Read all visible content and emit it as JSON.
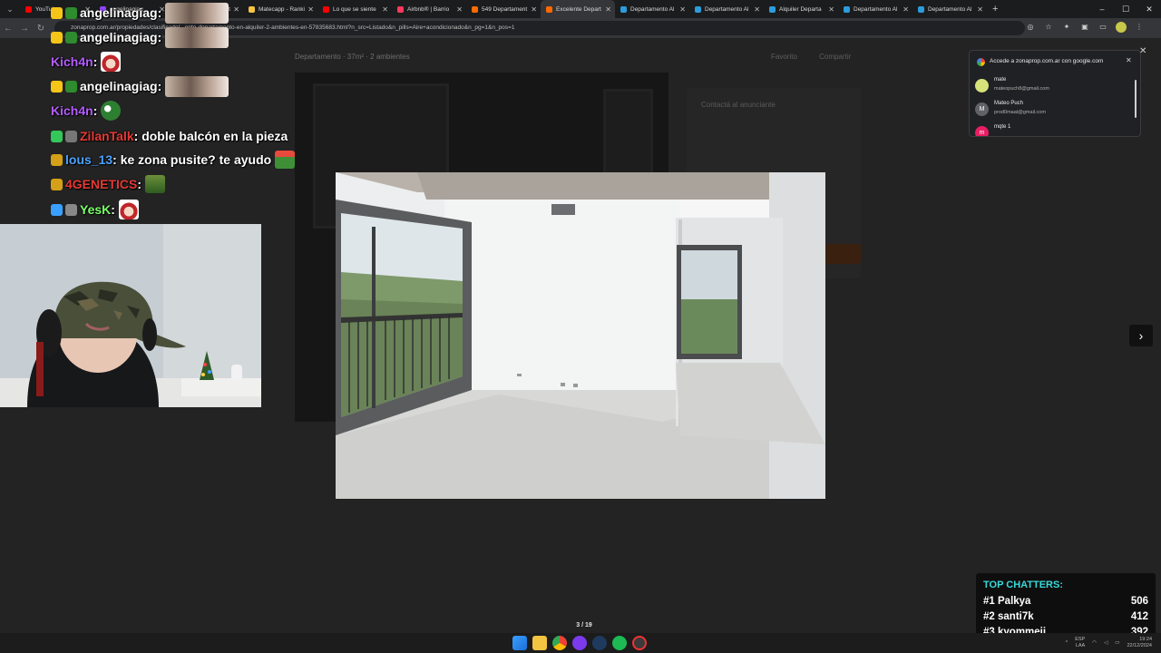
{
  "browser": {
    "tabs": [
      {
        "title": "YouTube",
        "color": "#ff0000"
      },
      {
        "title": "angelinagiag",
        "color": "#9146ff"
      },
      {
        "title": "KickBot VOD Edit",
        "color": "#53fc18"
      },
      {
        "title": "Matecapp - Ranki",
        "color": "#f5c542"
      },
      {
        "title": "Lo que se siente",
        "color": "#ff0000"
      },
      {
        "title": "Airbnb® | Barrio",
        "color": "#ff385c"
      },
      {
        "title": "549 Departament",
        "color": "#ff6a00"
      },
      {
        "title": "Excelente Depart",
        "color": "#ff6a00",
        "active": true
      },
      {
        "title": "Departamento Al",
        "color": "#2d9cdb"
      },
      {
        "title": "Departamento Al",
        "color": "#2d9cdb"
      },
      {
        "title": "Alquiler Departa",
        "color": "#2d9cdb"
      },
      {
        "title": "Departamento Al",
        "color": "#2d9cdb"
      },
      {
        "title": "Departamento Al",
        "color": "#2d9cdb"
      }
    ],
    "url": "zonaprop.com.ar/propiedades/clasificado/...ente-departamento-en-alquiler-2-ambientes-en-57835683.html?n_src=Listado&n_pills=Aire+acondicionado&n_pg=1&n_pos=1"
  },
  "page": {
    "breadcrumb": "Departamento · 37m² · 2 ambientes",
    "actions": [
      "Favorito",
      "Compartir"
    ],
    "contact_title": "Contactá al anunciante"
  },
  "lightbox": {
    "counter": "3 / 19"
  },
  "google_popup": {
    "title": "Accede a zonaprop.com.ar con google.com",
    "accounts": [
      {
        "name": "mate",
        "email": "mateopuch8@gmail.com",
        "avatar": "",
        "color": "#d6e27a"
      },
      {
        "name": "Mateo Puch",
        "email": "prod0maat@gmail.com",
        "avatar": "M",
        "color": "#5f6368"
      },
      {
        "name": "mqte 1",
        "email": "",
        "avatar": "m",
        "color": "#e91e63"
      }
    ]
  },
  "chat": [
    {
      "user": "angelinagiag",
      "color": "#ffffff",
      "text": ":",
      "emote": "face"
    },
    {
      "user": "angelinagiag",
      "color": "#ffffff",
      "text": ":",
      "emote": "face"
    },
    {
      "user": "Kich4n",
      "color": "#b45cff",
      "text": ":",
      "emote": "santa"
    },
    {
      "user": "angelinagiag",
      "color": "#ffffff",
      "text": ":",
      "emote": "face"
    },
    {
      "user": "Kich4n",
      "color": "#b45cff",
      "text": ":",
      "emote": "frog"
    },
    {
      "user": "ZilanTalk",
      "color": "#e53935",
      "text": ": doble balcón en la pieza",
      "emote": ""
    },
    {
      "user": "lous_13",
      "color": "#4aa3ff",
      "text": ": ke zona pusite? te ayudo",
      "emote": "frog2"
    },
    {
      "user": "4GENETICS",
      "color": "#e53935",
      "text": ":",
      "emote": "sign"
    },
    {
      "user": "YesK",
      "color": "#7cff6b",
      "text": ":",
      "emote": "santa"
    }
  ],
  "top_chatters": {
    "title": "TOP CHATTERS:",
    "rows": [
      {
        "rank": "#1",
        "name": "Palkya",
        "count": "506"
      },
      {
        "rank": "#2",
        "name": "santi7k",
        "count": "412"
      },
      {
        "rank": "#3",
        "name": "kyommeii",
        "count": "392"
      }
    ]
  },
  "taskbar": {
    "lang": "ESP",
    "lang2": "LAA",
    "time": "19:24",
    "date": "22/12/2024"
  }
}
